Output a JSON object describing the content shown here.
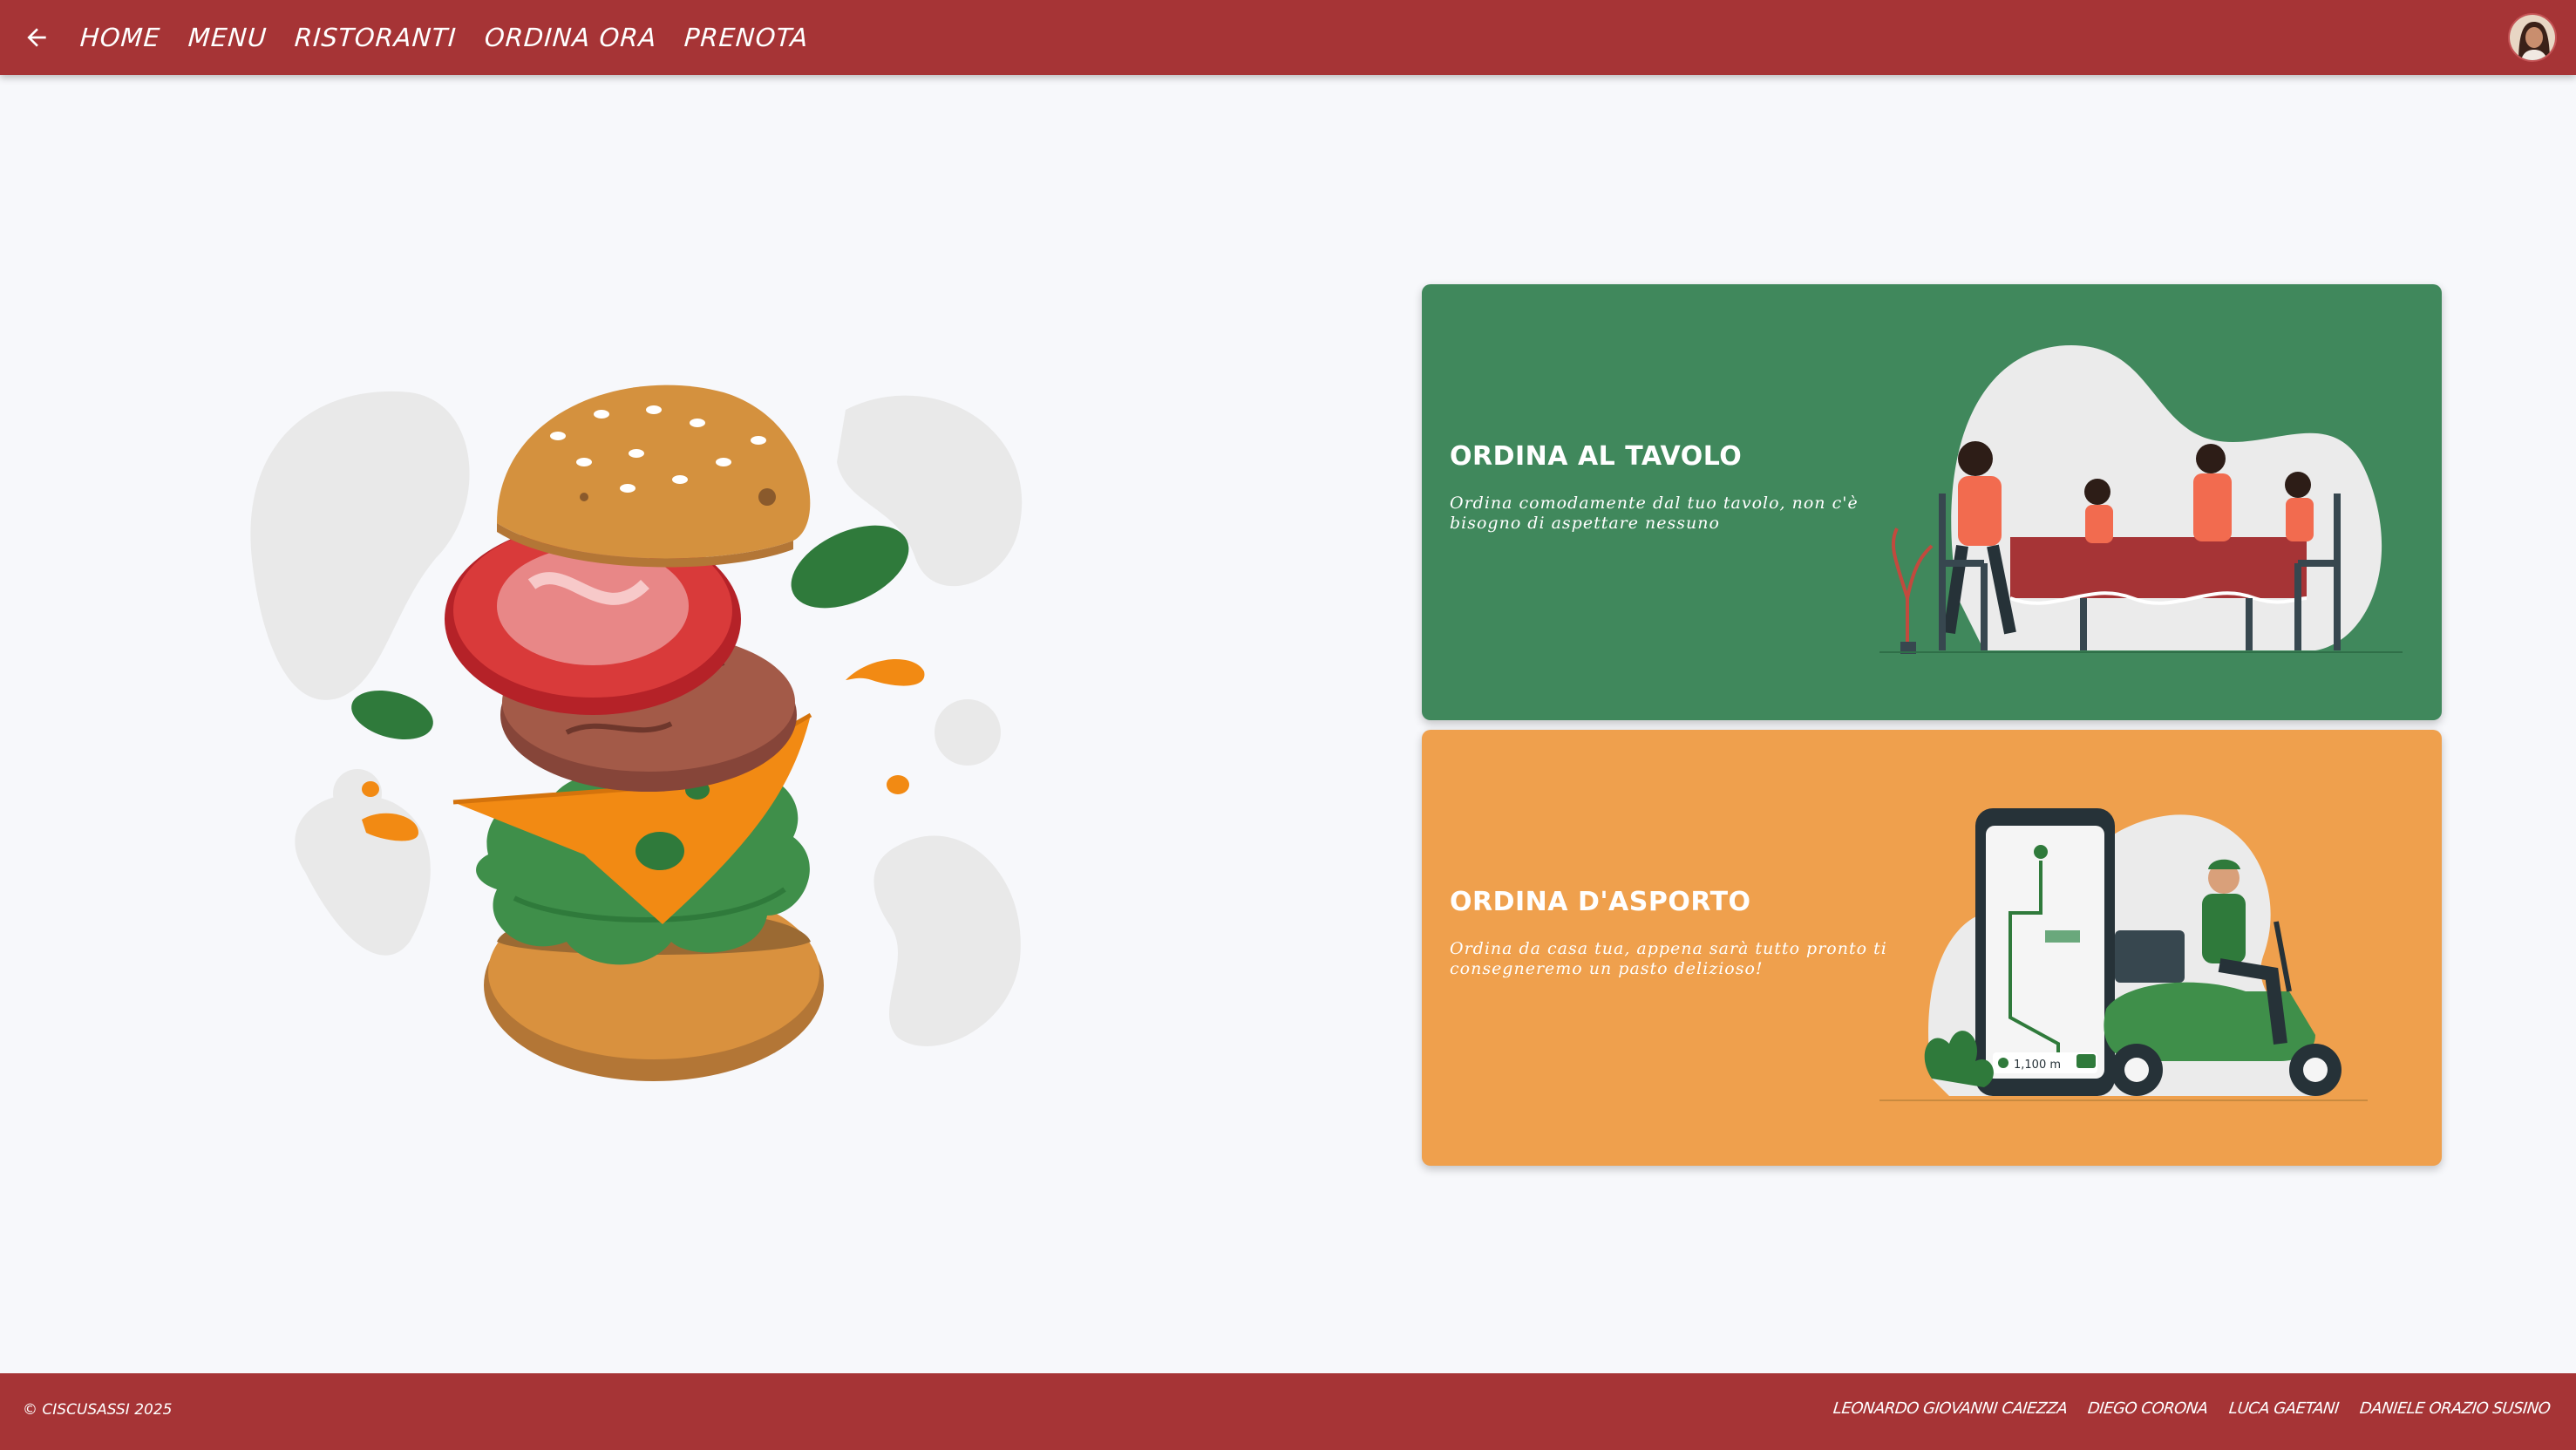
{
  "header": {
    "back_icon": "arrow-left-icon",
    "nav": [
      {
        "label": "HOME"
      },
      {
        "label": "MENU"
      },
      {
        "label": "RISTORANTI"
      },
      {
        "label": "ORDINA ORA"
      },
      {
        "label": "PRENOTA"
      }
    ],
    "avatar_icon": "user-avatar"
  },
  "main": {
    "hero_icon": "burger-illustration",
    "cards": [
      {
        "title": "ORDINA AL TAVOLO",
        "description": "Ordina comodamente dal tuo tavolo, non c'è bisogno di aspettare nessuno",
        "illustration": "family-dining-illustration",
        "color": "#40885c"
      },
      {
        "title": "ORDINA D'ASPORTO",
        "description": "Ordina da casa tua, appena sarà tutto pronto ti consegneremo un pasto delizioso!",
        "illustration": "delivery-scooter-illustration",
        "phone_distance": "1,100 m",
        "color": "#efa04d"
      }
    ]
  },
  "footer": {
    "copyright": "© CISCUSASSI 2025",
    "authors": [
      "LEONARDO GIOVANNI CAIEZZA",
      "DIEGO CORONA",
      "LUCA GAETANI",
      "DANIELE ORAZIO SUSINO"
    ]
  },
  "colors": {
    "header": "#a63436",
    "background": "#f7f8fb",
    "green_card": "#40885c",
    "orange_card": "#efa04d"
  }
}
